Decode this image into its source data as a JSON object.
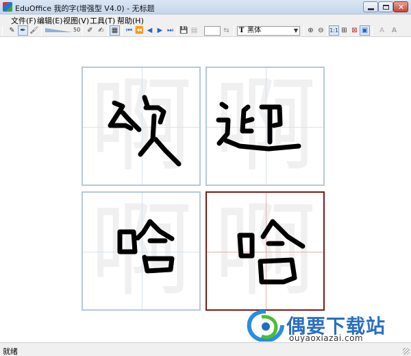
{
  "window": {
    "title": "EduOffice 我的字(增强型 V4.0) - 无标题"
  },
  "menu": [
    "文件(F)",
    "编辑(E)",
    "视图(V)",
    "工具(T)",
    "帮助(H)"
  ],
  "toolbar": {
    "pen_size_value": "50",
    "font_name": "黑体",
    "font_icon": "T",
    "view_buttons": [
      "1:1",
      "⊞",
      "⊠",
      "▣",
      "A",
      "A"
    ]
  },
  "grid": {
    "cells": [
      {
        "ghost_char": "啊",
        "active": false
      },
      {
        "ghost_char": "啊",
        "active": false
      },
      {
        "ghost_char": "啊",
        "active": false
      },
      {
        "ghost_char": "啊",
        "active": true
      }
    ]
  },
  "watermark": {
    "name": "偶要下载站",
    "url": "ouyaoxiazai.com"
  },
  "status": {
    "text": "就绪"
  }
}
